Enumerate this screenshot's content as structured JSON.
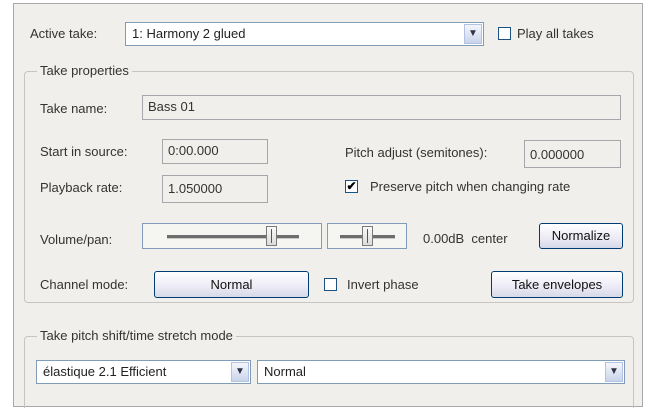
{
  "active_take": {
    "label": "Active take:",
    "value": "1: Harmony 2 glued",
    "play_all_label": "Play all takes",
    "play_all_checked": false
  },
  "take_properties": {
    "title": "Take properties",
    "take_name_label": "Take name:",
    "take_name_value": "Bass 01",
    "start_label": "Start in source:",
    "start_value": "0:00.000",
    "pitch_label": "Pitch adjust (semitones):",
    "pitch_value": "0.000000",
    "rate_label": "Playback rate:",
    "rate_value": "1.050000",
    "preserve_label": "Preserve pitch when changing rate",
    "preserve_checked": true,
    "volpan_label": "Volume/pan:",
    "volume_fraction": 0.83,
    "pan_fraction": 0.5,
    "volpan_readout": "0.00dB  center",
    "normalize_label": "Normalize",
    "channel_label": "Channel mode:",
    "channel_value": "Normal",
    "invert_label": "Invert phase",
    "invert_checked": false,
    "envelopes_label": "Take envelopes"
  },
  "pitch_shift": {
    "title": "Take pitch shift/time stretch mode",
    "algorithm_value": "élastique 2.1 Efficient",
    "mode_value": "Normal"
  },
  "icons": {
    "dropdown": "chevron-down-icon",
    "check": "checkmark-icon"
  }
}
